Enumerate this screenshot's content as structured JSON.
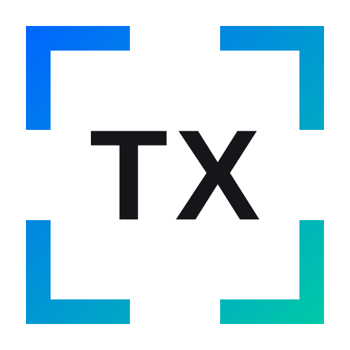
{
  "logo": {
    "text": "TX",
    "text_color": "#151619",
    "gradient_start": "#0066FF",
    "gradient_end": "#00C9A7",
    "icon": "viewfinder-corner-brackets-icon"
  }
}
